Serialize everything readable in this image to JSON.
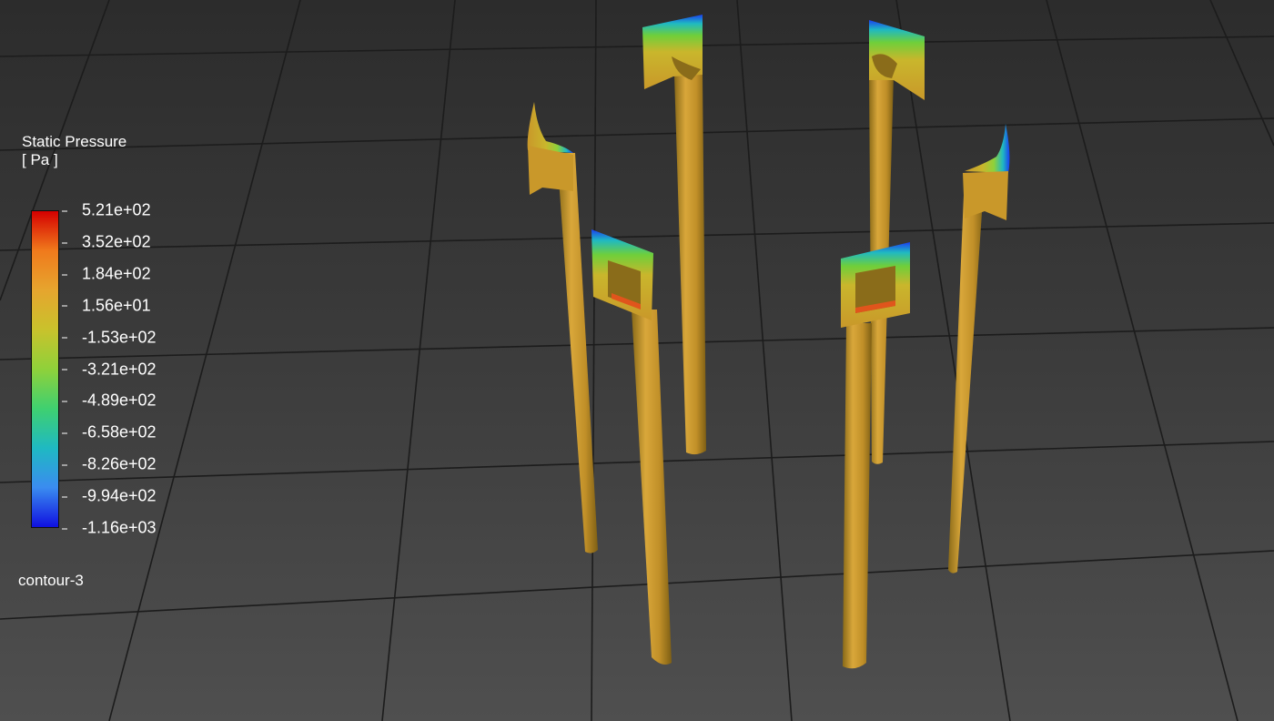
{
  "legend": {
    "title": "Static Pressure",
    "unit": "[ Pa ]",
    "ticks": [
      "5.21e+02",
      "3.52e+02",
      "1.84e+02",
      "1.56e+01",
      "-1.53e+02",
      "-3.21e+02",
      "-4.89e+02",
      "-6.58e+02",
      "-8.26e+02",
      "-9.94e+02",
      "-1.16e+03"
    ],
    "colors": [
      "#d40000",
      "#f07a1c",
      "#e6a52e",
      "#c9c22c",
      "#8fd13a",
      "#3fd070",
      "#1fb9c2",
      "#3a8cf0",
      "#1010e0"
    ]
  },
  "contour_name": "contour-3",
  "scene": {
    "background_colors": [
      "#2c2c2c",
      "#4f4f4f"
    ],
    "grid_color": "#1e1e1e",
    "pole_color": "#c8962a",
    "object_count": 6
  }
}
